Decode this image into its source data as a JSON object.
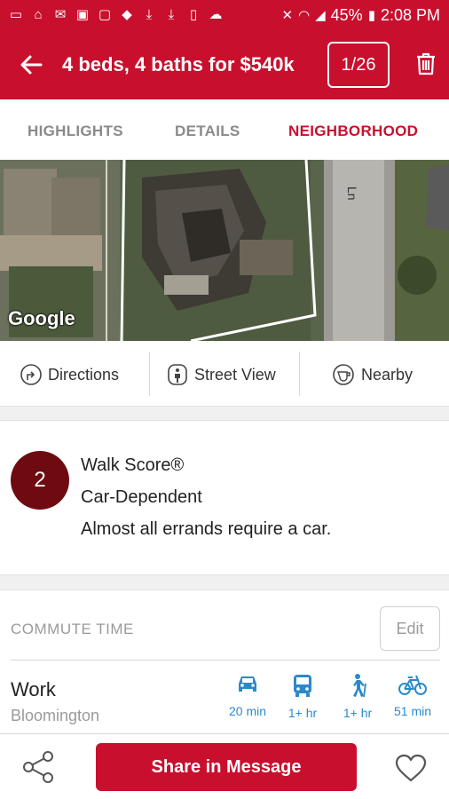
{
  "status_bar": {
    "battery": "45%",
    "time": "2:08 PM",
    "left_icons": [
      "message-icon",
      "home-icon",
      "mail-icon",
      "image-icon",
      "cast-icon",
      "dropbox-icon",
      "download-icon",
      "download-icon",
      "tablet-icon",
      "weather-icon"
    ],
    "right_icons": [
      "mute-icon",
      "wifi-icon",
      "signal-icon",
      "battery-icon"
    ]
  },
  "app_bar": {
    "title": "4 beds, 4 baths for $540k",
    "counter": "1/26",
    "back_icon": "arrow-left-icon",
    "delete_icon": "trash-icon"
  },
  "tabs": [
    {
      "label": "HIGHLIGHTS",
      "active": false
    },
    {
      "label": "DETAILS",
      "active": false
    },
    {
      "label": "NEIGHBORHOOD",
      "active": true
    }
  ],
  "map": {
    "provider_logo": "Google",
    "street_label": "Ln"
  },
  "map_actions": [
    {
      "label": "Directions",
      "icon": "directions-icon"
    },
    {
      "label": "Street View",
      "icon": "street-view-icon"
    },
    {
      "label": "Nearby",
      "icon": "nearby-icon"
    }
  ],
  "walk_score": {
    "score": "2",
    "title": "Walk Score®",
    "category": "Car-Dependent",
    "description": "Almost all errands require a car.",
    "color": "#6e0b10"
  },
  "commute": {
    "header": "COMMUTE TIME",
    "edit_label": "Edit",
    "destination": "Work",
    "location": "Bloomington",
    "modes": [
      {
        "icon": "car-icon",
        "time": "20 min"
      },
      {
        "icon": "bus-icon",
        "time": "1+ hr"
      },
      {
        "icon": "walk-icon",
        "time": "1+ hr"
      },
      {
        "icon": "bike-icon",
        "time": "51 min"
      }
    ]
  },
  "bottom_bar": {
    "share_label": "Share in Message",
    "share_icon": "share-icon",
    "favorite_icon": "heart-icon"
  },
  "colors": {
    "brand": "#c8102e",
    "link": "#2a8ac9",
    "muted": "#9a9a9a"
  }
}
